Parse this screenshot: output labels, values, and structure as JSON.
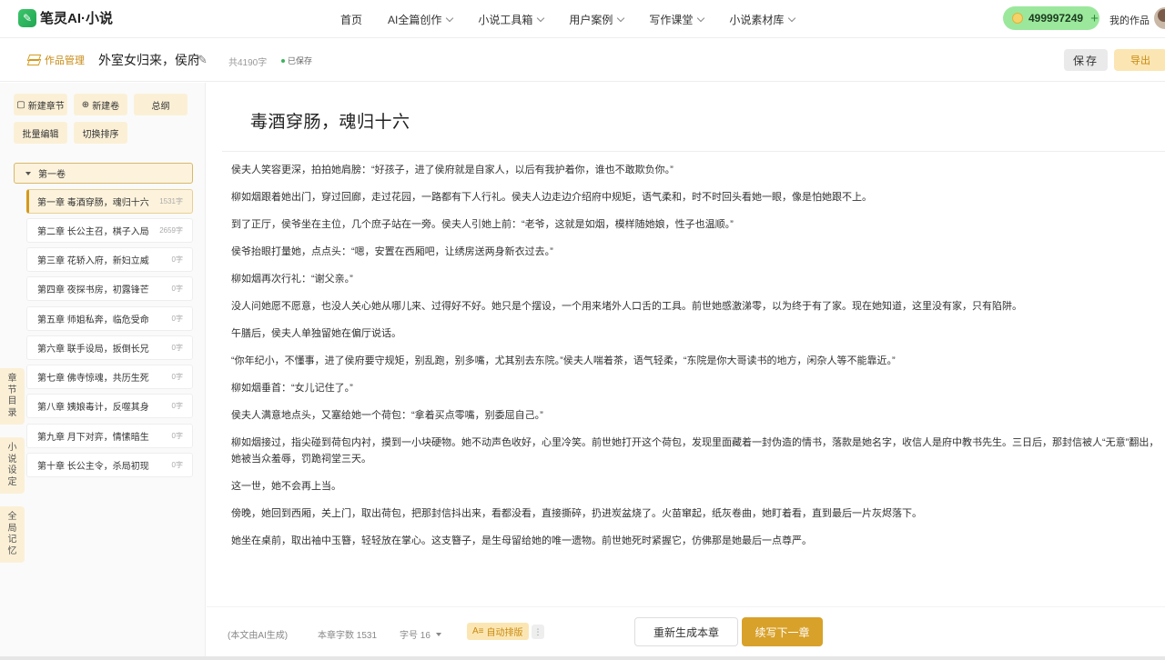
{
  "brand": {
    "logo_text": "笔灵AI·小说"
  },
  "nav": {
    "items": [
      {
        "label": "首页",
        "has_dropdown": false
      },
      {
        "label": "AI全篇创作",
        "has_dropdown": true
      },
      {
        "label": "小说工具箱",
        "has_dropdown": true
      },
      {
        "label": "用户案例",
        "has_dropdown": true
      },
      {
        "label": "写作课堂",
        "has_dropdown": true
      },
      {
        "label": "小说素材库",
        "has_dropdown": true
      }
    ],
    "credits": "499997249",
    "my_works": "我的作品"
  },
  "toolbar": {
    "manage_label": "作品管理",
    "work_title": "外室女归来，侯府扌",
    "word_count": "共4190字",
    "save_status": "已保存",
    "save_label": "保存",
    "export_label": "导出"
  },
  "sidebar": {
    "buttons": {
      "new_chapter": "新建章节",
      "new_volume": "新建卷",
      "outline": "总纲",
      "batch_edit": "批量编辑",
      "switch_sort": "切换排序"
    },
    "volume": "第一卷",
    "chapters": [
      {
        "title": "第一章 毒酒穿肠，魂归十六",
        "count": "1531字"
      },
      {
        "title": "第二章 长公主召，棋子入局",
        "count": "2659字"
      },
      {
        "title": "第三章 花轿入府，新妇立威",
        "count": "0字"
      },
      {
        "title": "第四章 夜探书房，初露锋芒",
        "count": "0字"
      },
      {
        "title": "第五章 师姐私奔，临危受命",
        "count": "0字"
      },
      {
        "title": "第六章 联手设局，扳倒长兄",
        "count": "0字"
      },
      {
        "title": "第七章 佛寺惊魂，共历生死",
        "count": "0字"
      },
      {
        "title": "第八章 姨娘毒计，反噬其身",
        "count": "0字"
      },
      {
        "title": "第九章 月下对弈，情愫暗生",
        "count": "0字"
      },
      {
        "title": "第十章 长公主令，杀局初现",
        "count": "0字"
      }
    ],
    "side_tabs": [
      "章节目录",
      "小说设定",
      "全局记忆"
    ]
  },
  "editor": {
    "chapter_title": "毒酒穿肠，魂归十六",
    "paragraphs": [
      "侯夫人笑容更深，拍拍她肩膀：“好孩子，进了侯府就是自家人，以后有我护着你，谁也不敢欺负你。”",
      "柳如烟跟着她出门，穿过回廊，走过花园，一路都有下人行礼。侯夫人边走边介绍府中规矩，语气柔和，时不时回头看她一眼，像是怕她跟不上。",
      "到了正厅，侯爷坐在主位，几个庶子站在一旁。侯夫人引她上前：“老爷，这就是如烟，模样随她娘，性子也温顺。”",
      "侯爷抬眼打量她，点点头：“嗯，安置在西厢吧，让绣房送两身新衣过去。”",
      "柳如烟再次行礼：“谢父亲。”",
      "没人问她愿不愿意，也没人关心她从哪儿来、过得好不好。她只是个摆设，一个用来堵外人口舌的工具。前世她感激涕零，以为终于有了家。现在她知道，这里没有家，只有陷阱。",
      "午膳后，侯夫人单独留她在偏厅说话。",
      "“你年纪小，不懂事，进了侯府要守规矩，别乱跑，别多嘴，尤其别去东院。”侯夫人喘着茶，语气轻柔，“东院是你大哥读书的地方，闲杂人等不能靠近。”",
      "柳如烟垂首：“女儿记住了。”",
      "侯夫人满意地点头，又塞给她一个荷包：“拿着买点零嘴，别委屈自己。”",
      "柳如烟接过，指尖碰到荷包内衬，摸到一小块硬物。她不动声色收好，心里冷笑。前世她打开这个荷包，发现里面藏着一封伪造的情书，落款是她名字，收信人是府中教书先生。三日后，那封信被人“无意”翻出，她被当众羞辱，罚跪祠堂三天。",
      "这一世，她不会再上当。",
      "傍晚，她回到西厢，关上门，取出荷包，把那封信抖出来，看都没看，直接撕碎，扔进炭盆烧了。火苗窜起，纸灰卷曲，她盯着看，直到最后一片灰烬落下。",
      "她坐在桌前，取出袖中玉簪，轻轻放在掌心。这支簪子，是生母留给她的唯一遗物。前世她死时紧握它，仿佛那是她最后一点尊严。"
    ]
  },
  "bottom": {
    "ai_note": "(本文由AI生成)",
    "chapter_count": "本章字数 1531",
    "font_size": "字号 16",
    "auto_layout": "自动排版",
    "more": "⋮",
    "regenerate": "重新生成本章",
    "continue": "续写下一章"
  },
  "colors": {
    "accent": "#d8a12a",
    "accent_light": "#fbe6b3",
    "credits_bg": "#9be89d"
  }
}
